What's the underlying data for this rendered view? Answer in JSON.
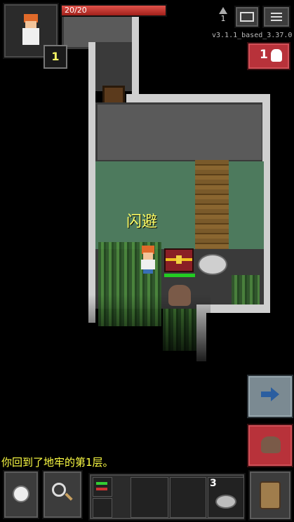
{
  "hud": {
    "hp_text": "20/20",
    "hero_level": "1",
    "depth": "1",
    "version": "v3.1.1_based_3.37.0",
    "danger_count": "1"
  },
  "world": {
    "floating_text": "闪避"
  },
  "log": {
    "message": "你回到了地牢的第1层。"
  },
  "toolbar": {
    "quickslot_count": "3"
  },
  "colors": {
    "hp_bar": "#c0392b",
    "log_text": "#ffff44",
    "danger_button": "#b8323a"
  },
  "icons": {
    "journal": "journal-icon",
    "menu": "menu-icon",
    "danger": "skull-icon",
    "wait": "clock-icon",
    "search": "magnifier-icon",
    "swap": "swap-arrows-icon",
    "backpack": "backpack-icon",
    "resume": "arrow-right-icon",
    "attack": "rat-icon"
  }
}
